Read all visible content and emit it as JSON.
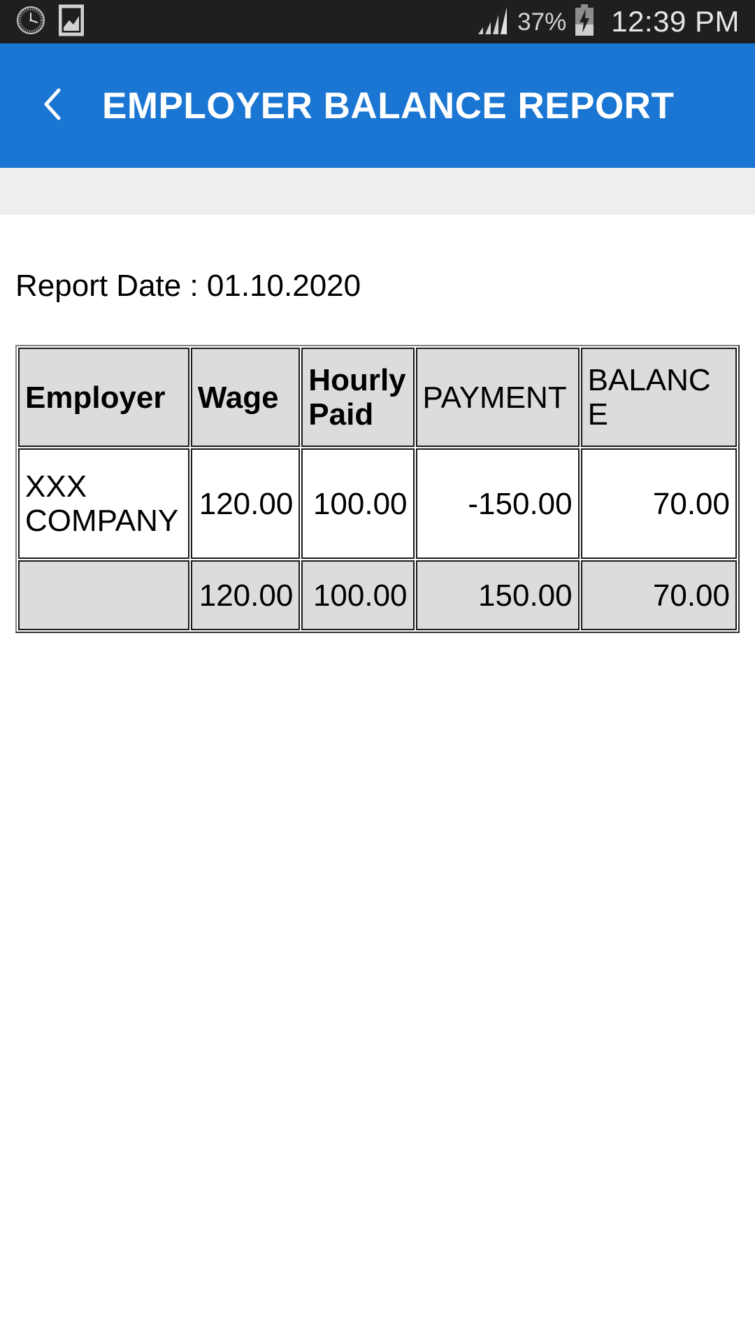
{
  "status_bar": {
    "icons": [
      "clock-icon",
      "photo-icon"
    ],
    "signal_icon": "signal-bars-icon",
    "battery_percent": "37%",
    "battery_icon": "battery-charging-icon",
    "time": "12:39 PM",
    "background_color": "#1f1f1f"
  },
  "app_bar": {
    "back_icon": "chevron-left-icon",
    "title": "EMPLOYER BALANCE REPORT",
    "background_color": "#1a76d2",
    "text_color": "#ffffff"
  },
  "content": {
    "report_date_label": "Report Date : 01.10.2020"
  },
  "table": {
    "headers": [
      "Employer",
      "Wage",
      "Hourly Paid",
      "PAYMENT",
      "BALANCE"
    ],
    "rows": [
      {
        "employer": "XXX COMPANY",
        "wage": "120.00",
        "hourly_paid": "100.00",
        "payment": "-150.00",
        "balance": "70.00"
      }
    ],
    "totals": {
      "employer": "",
      "wage": "120.00",
      "hourly_paid": "100.00",
      "payment": "150.00",
      "balance": "70.00"
    },
    "header_background": "#dcdcdc",
    "total_background": "#dcdcdc",
    "border_color": "#1a1a1a"
  }
}
